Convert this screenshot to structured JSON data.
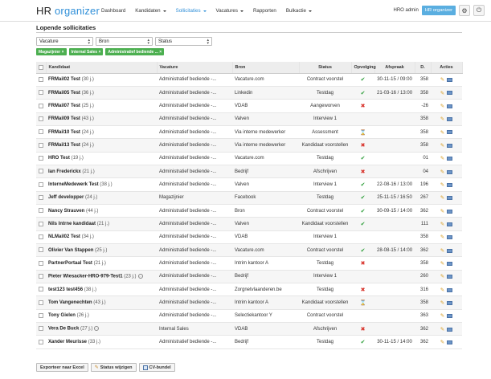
{
  "app": {
    "logo_part1": "HR ",
    "logo_part2": "organizer"
  },
  "nav": [
    {
      "label": "Dashboard",
      "dropdown": false,
      "active": false
    },
    {
      "label": "Kandidaten",
      "dropdown": true,
      "active": false
    },
    {
      "label": "Sollicitaties",
      "dropdown": true,
      "active": true
    },
    {
      "label": "Vacatures",
      "dropdown": true,
      "active": false
    },
    {
      "label": "Rapporten",
      "dropdown": false,
      "active": false
    },
    {
      "label": "Bulkactie",
      "dropdown": true,
      "active": false
    }
  ],
  "user": {
    "name": "HRO admin",
    "badge": "HR organizer",
    "settings_icon": "gear-icon",
    "power_icon": "power-icon"
  },
  "page_title": "Lopende sollicitaties",
  "filters": {
    "vacature": "Vacature",
    "bron": "Bron",
    "status": "Status"
  },
  "chips": [
    "Magazijnier",
    "Internal Sales",
    "Administratief bediende ..."
  ],
  "table": {
    "headers": {
      "kandidaat": "Kandidaat",
      "vacature": "Vacature",
      "bron": "Bron",
      "status": "Status",
      "opvolging": "Opvolging",
      "afspraak": "Afspraak",
      "d": "D.",
      "acties": "Acties"
    },
    "rows": [
      {
        "name": "FRMail02 Test",
        "age": "(30 j.)",
        "vacature": "Administratief bediende -...",
        "bron": "Vacature.com",
        "status": "Contract voorstel",
        "opvolging": "ok",
        "afspraak": "30-11-15 / 09:00",
        "d": "358",
        "info": false
      },
      {
        "name": "FRMail05 Test",
        "age": "(36 j.)",
        "vacature": "Administratief bediende -...",
        "bron": "Linkedin",
        "status": "Testdag",
        "opvolging": "ok",
        "afspraak": "21-03-16 / 13:00",
        "d": "358",
        "info": false
      },
      {
        "name": "FRMail07 Test",
        "age": "(25 j.)",
        "vacature": "Administratief bediende -...",
        "bron": "VDAB",
        "status": "Aangeworven",
        "opvolging": "no",
        "afspraak": "",
        "d": "-26",
        "info": false
      },
      {
        "name": "FRMail09 Test",
        "age": "(43 j.)",
        "vacature": "Administratief bediende -...",
        "bron": "Valven",
        "status": "Interview 1",
        "opvolging": "",
        "afspraak": "",
        "d": "358",
        "info": false
      },
      {
        "name": "FRMail10 Test",
        "age": "(24 j.)",
        "vacature": "Administratief bediende -...",
        "bron": "Via interne medewerker",
        "status": "Assessment",
        "opvolging": "wait",
        "afspraak": "",
        "d": "358",
        "info": false
      },
      {
        "name": "FRMail13 Test",
        "age": "(24 j.)",
        "vacature": "Administratief bediende -...",
        "bron": "Via interne medewerker",
        "status": "Kandidaat voorstellen",
        "opvolging": "no",
        "afspraak": "",
        "d": "358",
        "info": false
      },
      {
        "name": "HRO Test",
        "age": "(19 j.)",
        "vacature": "Administratief bediende -...",
        "bron": "Vacature.com",
        "status": "Testdag",
        "opvolging": "ok",
        "afspraak": "",
        "d": "01",
        "info": false
      },
      {
        "name": "Ian Frederickx",
        "age": "(21 j.)",
        "vacature": "Administratief bediende -...",
        "bron": "Bedrijf",
        "status": "Afschrijven",
        "opvolging": "no",
        "afspraak": "",
        "d": "04",
        "info": false
      },
      {
        "name": "InterneMedewerk Test",
        "age": "(38 j.)",
        "vacature": "Administratief bediende -...",
        "bron": "Valven",
        "status": "Interview 1",
        "opvolging": "ok",
        "afspraak": "22-08-16 / 13:00",
        "d": "196",
        "info": false
      },
      {
        "name": "Jeff developper",
        "age": "(24 j.)",
        "vacature": "Magazijnier",
        "bron": "Facebook",
        "status": "Testdag",
        "opvolging": "ok",
        "afspraak": "25-11-15 / 16:50",
        "d": "267",
        "info": false
      },
      {
        "name": "Nancy Strauven",
        "age": "(44 j.)",
        "vacature": "Administratief bediende -...",
        "bron": "Bron",
        "status": "Contract voorstel",
        "opvolging": "ok",
        "afspraak": "30-09-15 / 14:00",
        "d": "362",
        "info": false
      },
      {
        "name": "Nils Intrne kandidaat",
        "age": "(21 j.)",
        "vacature": "Administratief bediende -...",
        "bron": "Valven",
        "status": "Kandidaat voorstellen",
        "opvolging": "ok",
        "afspraak": "",
        "d": "111",
        "info": false
      },
      {
        "name": "NLMail02 Test",
        "age": "(34 j.)",
        "vacature": "Administratief bediende -...",
        "bron": "VDAB",
        "status": "Interview 1",
        "opvolging": "",
        "afspraak": "",
        "d": "358",
        "info": false
      },
      {
        "name": "Olivier Van Stappen",
        "age": "(25 j.)",
        "vacature": "Administratief bediende -...",
        "bron": "Vacature.com",
        "status": "Contract voorstel",
        "opvolging": "ok",
        "afspraak": "28-08-15 / 14:00",
        "d": "362",
        "info": false
      },
      {
        "name": "PartnerPortaal Test",
        "age": "(21 j.)",
        "vacature": "Administratief bediende -...",
        "bron": "Intrim kantoor A",
        "status": "Testdag",
        "opvolging": "no",
        "afspraak": "",
        "d": "358",
        "info": false
      },
      {
        "name": "Pieter Wiesacker-HRO-979-Test1",
        "age": "(23 j.)",
        "vacature": "Administratief bediende -...",
        "bron": "Bedrijf",
        "status": "Interview 1",
        "opvolging": "",
        "afspraak": "",
        "d": "260",
        "info": true
      },
      {
        "name": "test123 test456",
        "age": "(38 j.)",
        "vacature": "Administratief bediende -...",
        "bron": "Zorgnetvlaanderen.be",
        "status": "Testdag",
        "opvolging": "no",
        "afspraak": "",
        "d": "316",
        "info": false
      },
      {
        "name": "Tom Vangenechten",
        "age": "(43 j.)",
        "vacature": "Administratief bediende -...",
        "bron": "Intrim kantoor A",
        "status": "Kandidaat voorstellen",
        "opvolging": "wait",
        "afspraak": "",
        "d": "358",
        "info": false
      },
      {
        "name": "Tony Gielen",
        "age": "(26 j.)",
        "vacature": "Administratief bediende -...",
        "bron": "Selectiekantoor Y",
        "status": "Contract voorstel",
        "opvolging": "",
        "afspraak": "",
        "d": "363",
        "info": false
      },
      {
        "name": "Vera De Buck",
        "age": "(27 j.)",
        "vacature": "Internal Sales",
        "bron": "VDAB",
        "status": "Afschrijven",
        "opvolging": "no",
        "afspraak": "",
        "d": "362",
        "info": true
      },
      {
        "name": "Xander Meurisse",
        "age": "(33 j.)",
        "vacature": "Administratief bediende -...",
        "bron": "Bedrijf",
        "status": "Testdag",
        "opvolging": "ok",
        "afspraak": "30-11-15 / 14:00",
        "d": "362",
        "info": false
      }
    ]
  },
  "bottom": {
    "export": "Exporteer naar Excel",
    "status": "Status wijzigen",
    "cv": "CV-bundel"
  },
  "colors": {
    "accent": "#2f8fd8",
    "chip_green": "#4caf50",
    "ok": "#2e9e3a",
    "no": "#d8342c"
  }
}
